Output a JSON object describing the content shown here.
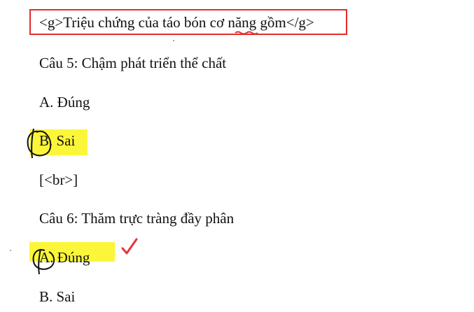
{
  "header": {
    "title": "<g>Triệu chứng của táo bón cơ năng gồm</g>"
  },
  "questions": [
    {
      "prompt": "Câu 5: Chậm phát triển thể chất",
      "options": [
        {
          "label": "A. Đúng"
        },
        {
          "label": "B. Sai"
        }
      ]
    },
    {
      "prompt": "Câu 6: Thăm trực tràng đầy phân",
      "options": [
        {
          "label": "A. Đúng"
        },
        {
          "label": "B. Sai"
        }
      ]
    }
  ],
  "separator": "[<br>]",
  "colors": {
    "box_border": "#e32b2b",
    "highlight": "#fbf63a",
    "check_mark": "#e8323c",
    "squiggle": "#e32b2b"
  }
}
